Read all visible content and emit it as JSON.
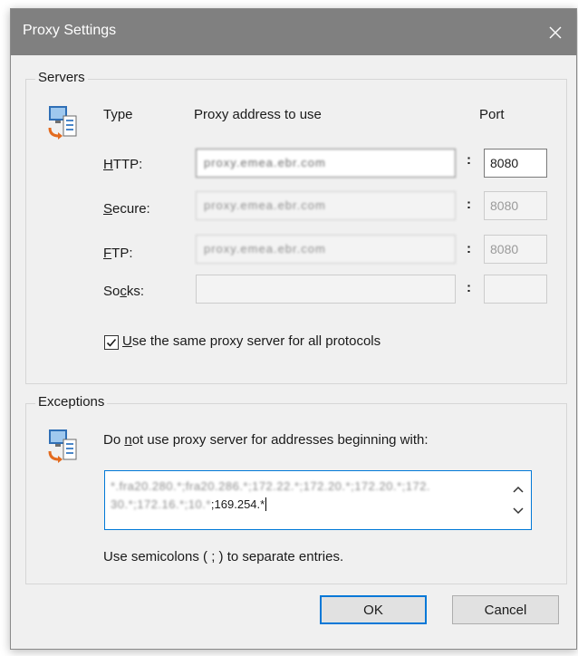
{
  "window": {
    "title": "Proxy Settings"
  },
  "servers": {
    "legend": "Servers",
    "header_type": "Type",
    "header_address": "Proxy address to use",
    "header_port": "Port",
    "rows": [
      {
        "label_pre": "",
        "label_key": "H",
        "label_post": "TTP:",
        "address": "proxy.emea.ebr.com",
        "port": "8080"
      },
      {
        "label_pre": "",
        "label_key": "S",
        "label_post": "ecure:",
        "address": "proxy.emea.ebr.com",
        "port": "8080"
      },
      {
        "label_pre": "",
        "label_key": "F",
        "label_post": "TP:",
        "address": "proxy.emea.ebr.com",
        "port": "8080"
      },
      {
        "label_pre": "So",
        "label_key": "c",
        "label_post": "ks:",
        "address": "",
        "port": ""
      }
    ],
    "colon": ":",
    "same_proxy": {
      "checked": true,
      "key": "U",
      "rest": "se the same proxy server for all protocols"
    }
  },
  "exceptions": {
    "legend": "Exceptions",
    "desc_pre": "Do ",
    "desc_key": "n",
    "desc_post": "ot use proxy server for addresses beginning with:",
    "line1_blurred": "*.fra20.280.*;fra20.286.*;172.22.*;172.20.*;172.20.*;172.",
    "line2_blurred": "30.*;172.16.*;10.*",
    "line2_clear": ";169.254.*",
    "hint": "Use semicolons ( ; ) to separate entries."
  },
  "buttons": {
    "ok": "OK",
    "cancel": "Cancel"
  },
  "colors": {
    "title_bar": "#808080",
    "accent": "#0078d7",
    "dialog_bg": "#f0f0f0"
  },
  "icons": {
    "close": "close-icon",
    "computer": "computer-icon",
    "check": "checkmark-icon",
    "scroll_up": "chevron-up-icon",
    "scroll_down": "chevron-down-icon"
  }
}
